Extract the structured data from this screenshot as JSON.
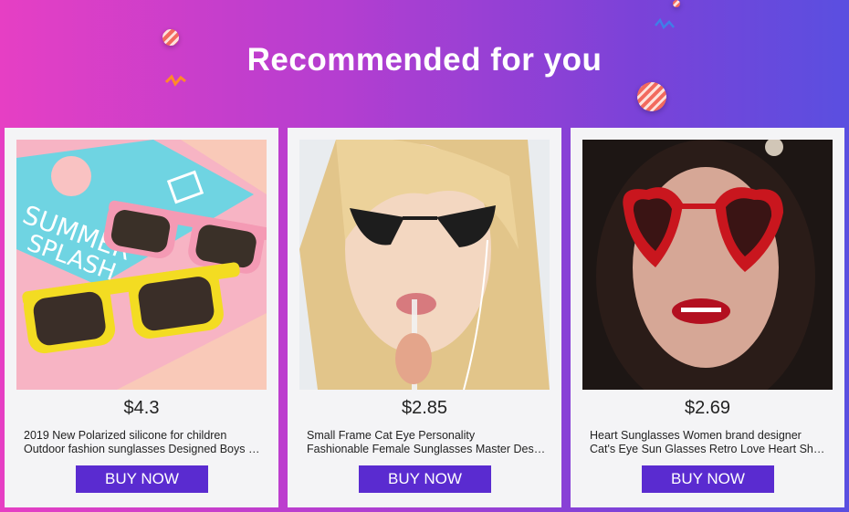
{
  "banner": {
    "title": "Recommended for you"
  },
  "products": [
    {
      "price": "$4.3",
      "title_line1": "2019 New Polarized silicone for children",
      "title_line2": "Outdoor fashion sunglasses Designed Boys Girls",
      "button_label": "BUY NOW",
      "image_icon": "kids-sunglasses-photo"
    },
    {
      "price": "$2.85",
      "title_line1": "Small Frame Cat Eye Personality",
      "title_line2": "Fashionable Female Sunglasses Master Design",
      "button_label": "BUY NOW",
      "image_icon": "cat-eye-sunglasses-photo"
    },
    {
      "price": "$2.69",
      "title_line1": "Heart Sunglasses Women brand designer",
      "title_line2": "Cat's Eye Sun Glasses Retro Love Heart Shaped",
      "button_label": "BUY NOW",
      "image_icon": "heart-sunglasses-photo"
    }
  ],
  "colors": {
    "button": "#5a2bd0",
    "card": "#f4f4f6",
    "gradient_left": "#e63fc4",
    "gradient_right": "#5a4fe0"
  }
}
